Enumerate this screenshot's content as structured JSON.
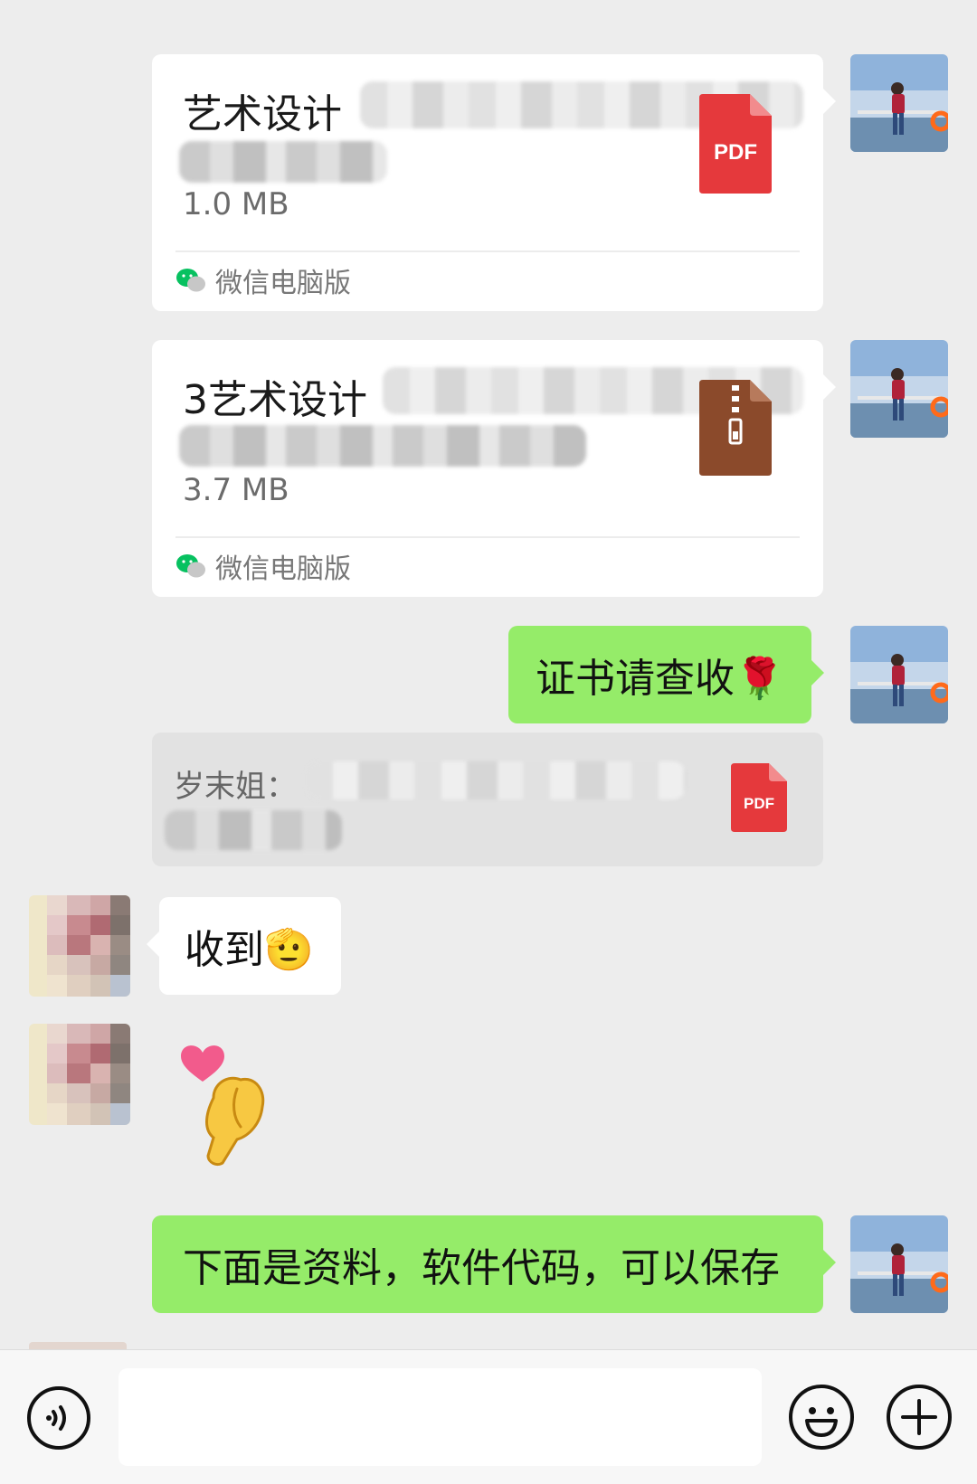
{
  "messages": {
    "file1": {
      "title_visible": "艺术设计",
      "size": "1.0 MB",
      "file_type": "PDF",
      "source": "微信电脑版"
    },
    "file2": {
      "title_visible": "3艺术设计",
      "size": "3.7 MB",
      "file_type": "zip",
      "source": "微信电脑版"
    },
    "text1": "证书请查收🌹",
    "quote": {
      "sender_visible": "岁末姐：",
      "file_type": "PDF"
    },
    "reply1": "收到🫡",
    "sticker": "heart-hand-sticker",
    "text2": "下面是资料，软件代码，可以保存"
  },
  "input_bar": {
    "voice_icon": "voice-icon",
    "emoji_icon": "emoji-icon",
    "plus_icon": "plus-icon",
    "placeholder": ""
  },
  "colors": {
    "background": "#ededed",
    "self_bubble": "#95ec69",
    "other_bubble": "#ffffff",
    "pdf_red": "#e5393c",
    "zip_brown": "#8b4a2b",
    "wechat_green": "#07c160"
  }
}
